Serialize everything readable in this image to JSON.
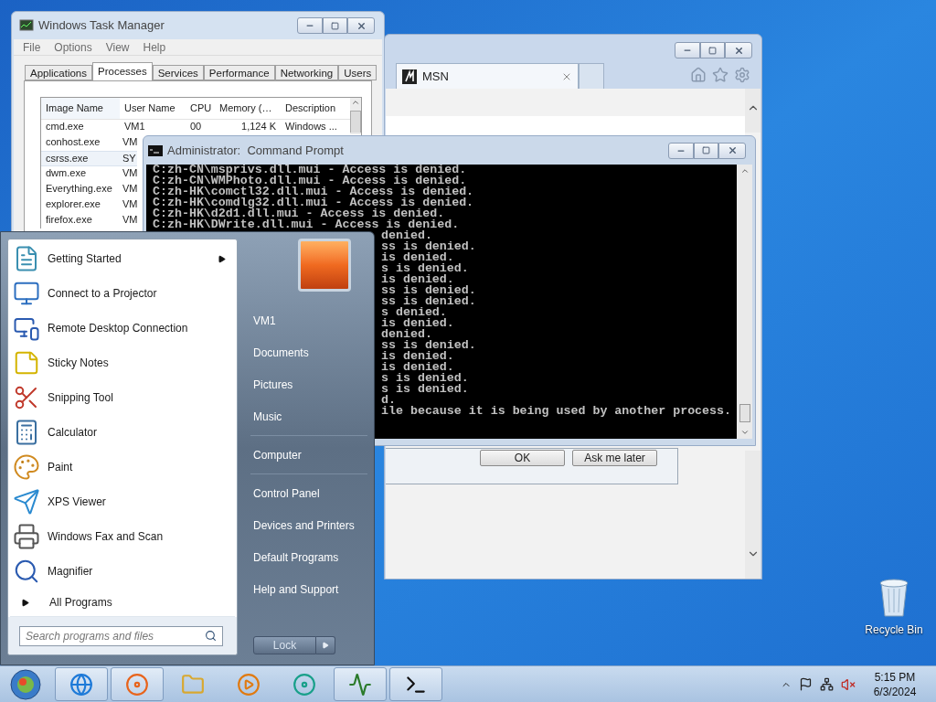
{
  "desktop": {
    "icons": [
      {
        "label": "Recycle Bin"
      }
    ]
  },
  "browser": {
    "tabs": [
      {
        "label": "MSN",
        "selected": true
      }
    ],
    "dialog_buttons": [
      "OK",
      "Ask me later"
    ]
  },
  "task_manager": {
    "title": "Windows Task Manager",
    "menu": [
      "File",
      "Options",
      "View",
      "Help"
    ],
    "tabs": [
      {
        "label": "Applications",
        "selected": false
      },
      {
        "label": "Processes",
        "selected": true
      },
      {
        "label": "Services",
        "selected": false
      },
      {
        "label": "Performance",
        "selected": false
      },
      {
        "label": "Networking",
        "selected": false
      },
      {
        "label": "Users",
        "selected": false
      }
    ],
    "columns": [
      "Image Name",
      "User Name",
      "CPU",
      "Memory (…",
      "Description"
    ],
    "rows": [
      {
        "cells": [
          "cmd.exe",
          "VM1",
          "00",
          "1,124 K",
          "Windows ..."
        ],
        "selected": false
      },
      {
        "cells": [
          "conhost.exe",
          "VM"
        ],
        "selected": false
      },
      {
        "cells": [
          "csrss.exe",
          "SY"
        ],
        "selected": true
      },
      {
        "cells": [
          "dwm.exe",
          "VM"
        ],
        "selected": false
      },
      {
        "cells": [
          "Everything.exe",
          "VM"
        ],
        "selected": false
      },
      {
        "cells": [
          "explorer.exe",
          "VM"
        ],
        "selected": false
      },
      {
        "cells": [
          "firefox.exe",
          "VM"
        ],
        "selected": false
      }
    ]
  },
  "command_prompt": {
    "title": "Administrator:  Command Prompt",
    "lines": [
      "C:zh-CN\\msprivs.dll.mui - Access is denied.",
      "C:zh-CN\\WMPhoto.dll.mui - Access is denied.",
      "C:zh-HK\\comctl32.dll.mui - Access is denied.",
      "C:zh-HK\\comdlg32.dll.mui - Access is denied.",
      "C:zh-HK\\d2d1.dll.mui - Access is denied.",
      "C:zh-HK\\DWrite.dll.mui - Access is denied."
    ],
    "lines_behind_start_menu": [
      "denied.",
      "ss is denied.",
      "is denied.",
      "s is denied.",
      "is denied.",
      "ss is denied.",
      "ss is denied.",
      "s denied.",
      "is denied.",
      "denied.",
      "ss is denied.",
      "is denied.",
      "is denied.",
      "s is denied.",
      "s is denied.",
      "d.",
      "ile because it is being used by another process."
    ]
  },
  "start_menu": {
    "programs": [
      {
        "label": "Getting Started",
        "submenu": true
      },
      {
        "label": "Connect to a Projector",
        "submenu": false
      },
      {
        "label": "Remote Desktop Connection",
        "submenu": false
      },
      {
        "label": "Sticky Notes",
        "submenu": false
      },
      {
        "label": "Snipping Tool",
        "submenu": false
      },
      {
        "label": "Calculator",
        "submenu": false
      },
      {
        "label": "Paint",
        "submenu": false
      },
      {
        "label": "XPS Viewer",
        "submenu": false
      },
      {
        "label": "Windows Fax and Scan",
        "submenu": false
      },
      {
        "label": "Magnifier",
        "submenu": false
      }
    ],
    "all_programs": "All Programs",
    "search": {
      "placeholder": "Search programs and files"
    },
    "places": [
      [
        "VM1",
        "Documents",
        "Pictures",
        "Music"
      ],
      [
        "Computer"
      ],
      [
        "Control Panel",
        "Devices and Printers",
        "Default Programs",
        "Help and Support"
      ]
    ],
    "shutdown": "Lock"
  },
  "taskbar": {
    "apps": [
      {
        "open": true
      },
      {
        "open": true
      },
      {
        "open": false
      },
      {
        "open": false
      },
      {
        "open": false
      },
      {
        "open": true
      },
      {
        "open": true
      }
    ],
    "clock": {
      "time": "5:15 PM",
      "date": "6/3/2024"
    }
  }
}
